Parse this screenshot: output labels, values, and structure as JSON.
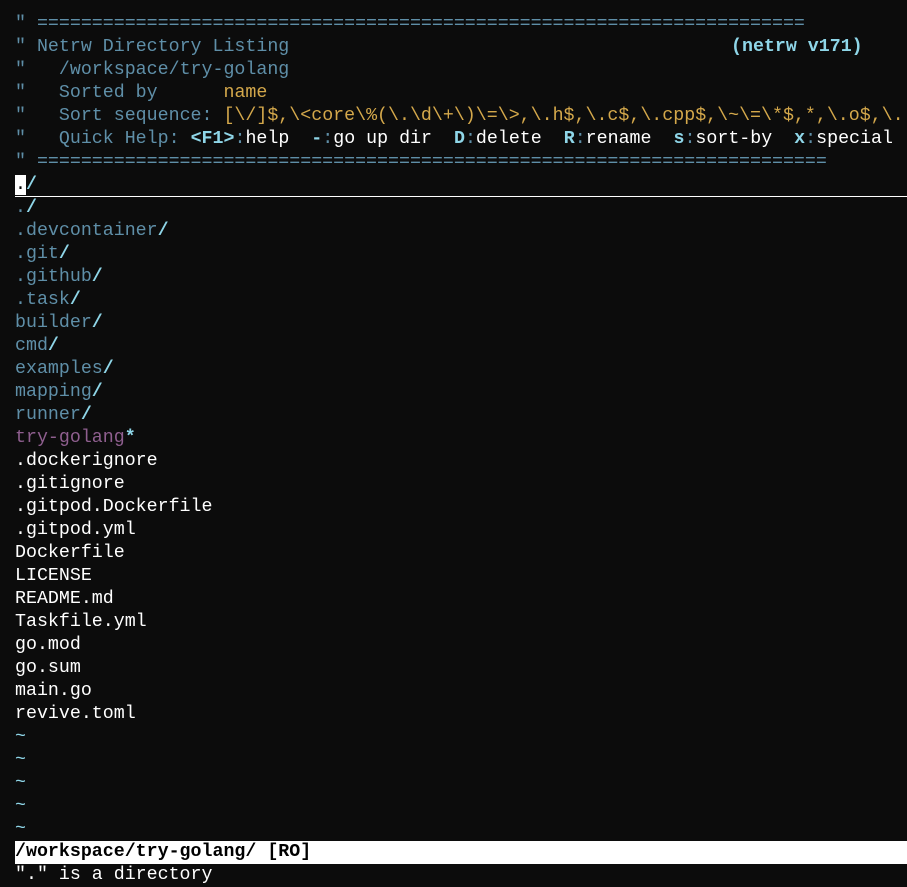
{
  "banner": {
    "sep_top": "\" ======================================================================",
    "title_quote": "\" ",
    "title": "Netrw Directory Listing",
    "version": "(netrw v171)",
    "path_quote": "\"   ",
    "path": "/workspace/try-golang",
    "sorted_quote": "\"   ",
    "sorted_label": "Sorted by",
    "sorted_pad": "      ",
    "sorted_value": "name",
    "seq_quote": "\"   ",
    "seq_label": "Sort sequence:",
    "seq_value": " [\\/]$,\\<core\\%(\\.\\d\\+\\)\\=\\>,\\.h$,\\.c$,\\.cpp$,\\~\\=\\*$,*,\\.o$,\\.",
    "help_quote": "\"   ",
    "help_label": "Quick Help:",
    "help_items": [
      {
        "key": "<F1>",
        "action": "help"
      },
      {
        "key": "-",
        "action": "go up dir"
      },
      {
        "key": "D",
        "action": "delete"
      },
      {
        "key": "R",
        "action": "rename"
      },
      {
        "key": "s",
        "action": "sort-by"
      },
      {
        "key": "x",
        "action": "special"
      }
    ],
    "sep_bottom": "\" ========================================================================"
  },
  "cursor_line": {
    "cursor_char": ".",
    "rest": "/"
  },
  "directories": [
    {
      "name": ".",
      "suffix": "/"
    },
    {
      "name": ".devcontainer",
      "suffix": "/"
    },
    {
      "name": ".git",
      "suffix": "/"
    },
    {
      "name": ".github",
      "suffix": "/"
    },
    {
      "name": ".task",
      "suffix": "/"
    },
    {
      "name": "builder",
      "suffix": "/"
    },
    {
      "name": "cmd",
      "suffix": "/"
    },
    {
      "name": "examples",
      "suffix": "/"
    },
    {
      "name": "mapping",
      "suffix": "/"
    },
    {
      "name": "runner",
      "suffix": "/"
    }
  ],
  "executable": {
    "name": "try-golang",
    "suffix": "*"
  },
  "files": [
    ".dockerignore",
    ".gitignore",
    ".gitpod.Dockerfile",
    ".gitpod.yml",
    "Dockerfile",
    "LICENSE",
    "README.md",
    "Taskfile.yml",
    "go.mod",
    "go.sum",
    "main.go",
    "revive.toml"
  ],
  "tildes": [
    "~",
    "~",
    "~",
    "~",
    "~"
  ],
  "statusline": "/workspace/try-golang/ [RO]",
  "message": "\".\" is a directory",
  "colors": {
    "background": "#0c0c0c",
    "comment": "#5f8fa8",
    "keyword": "#8fd6e8",
    "value": "#d4a84b",
    "executable": "#8f5f8f",
    "text": "#ffffff"
  }
}
